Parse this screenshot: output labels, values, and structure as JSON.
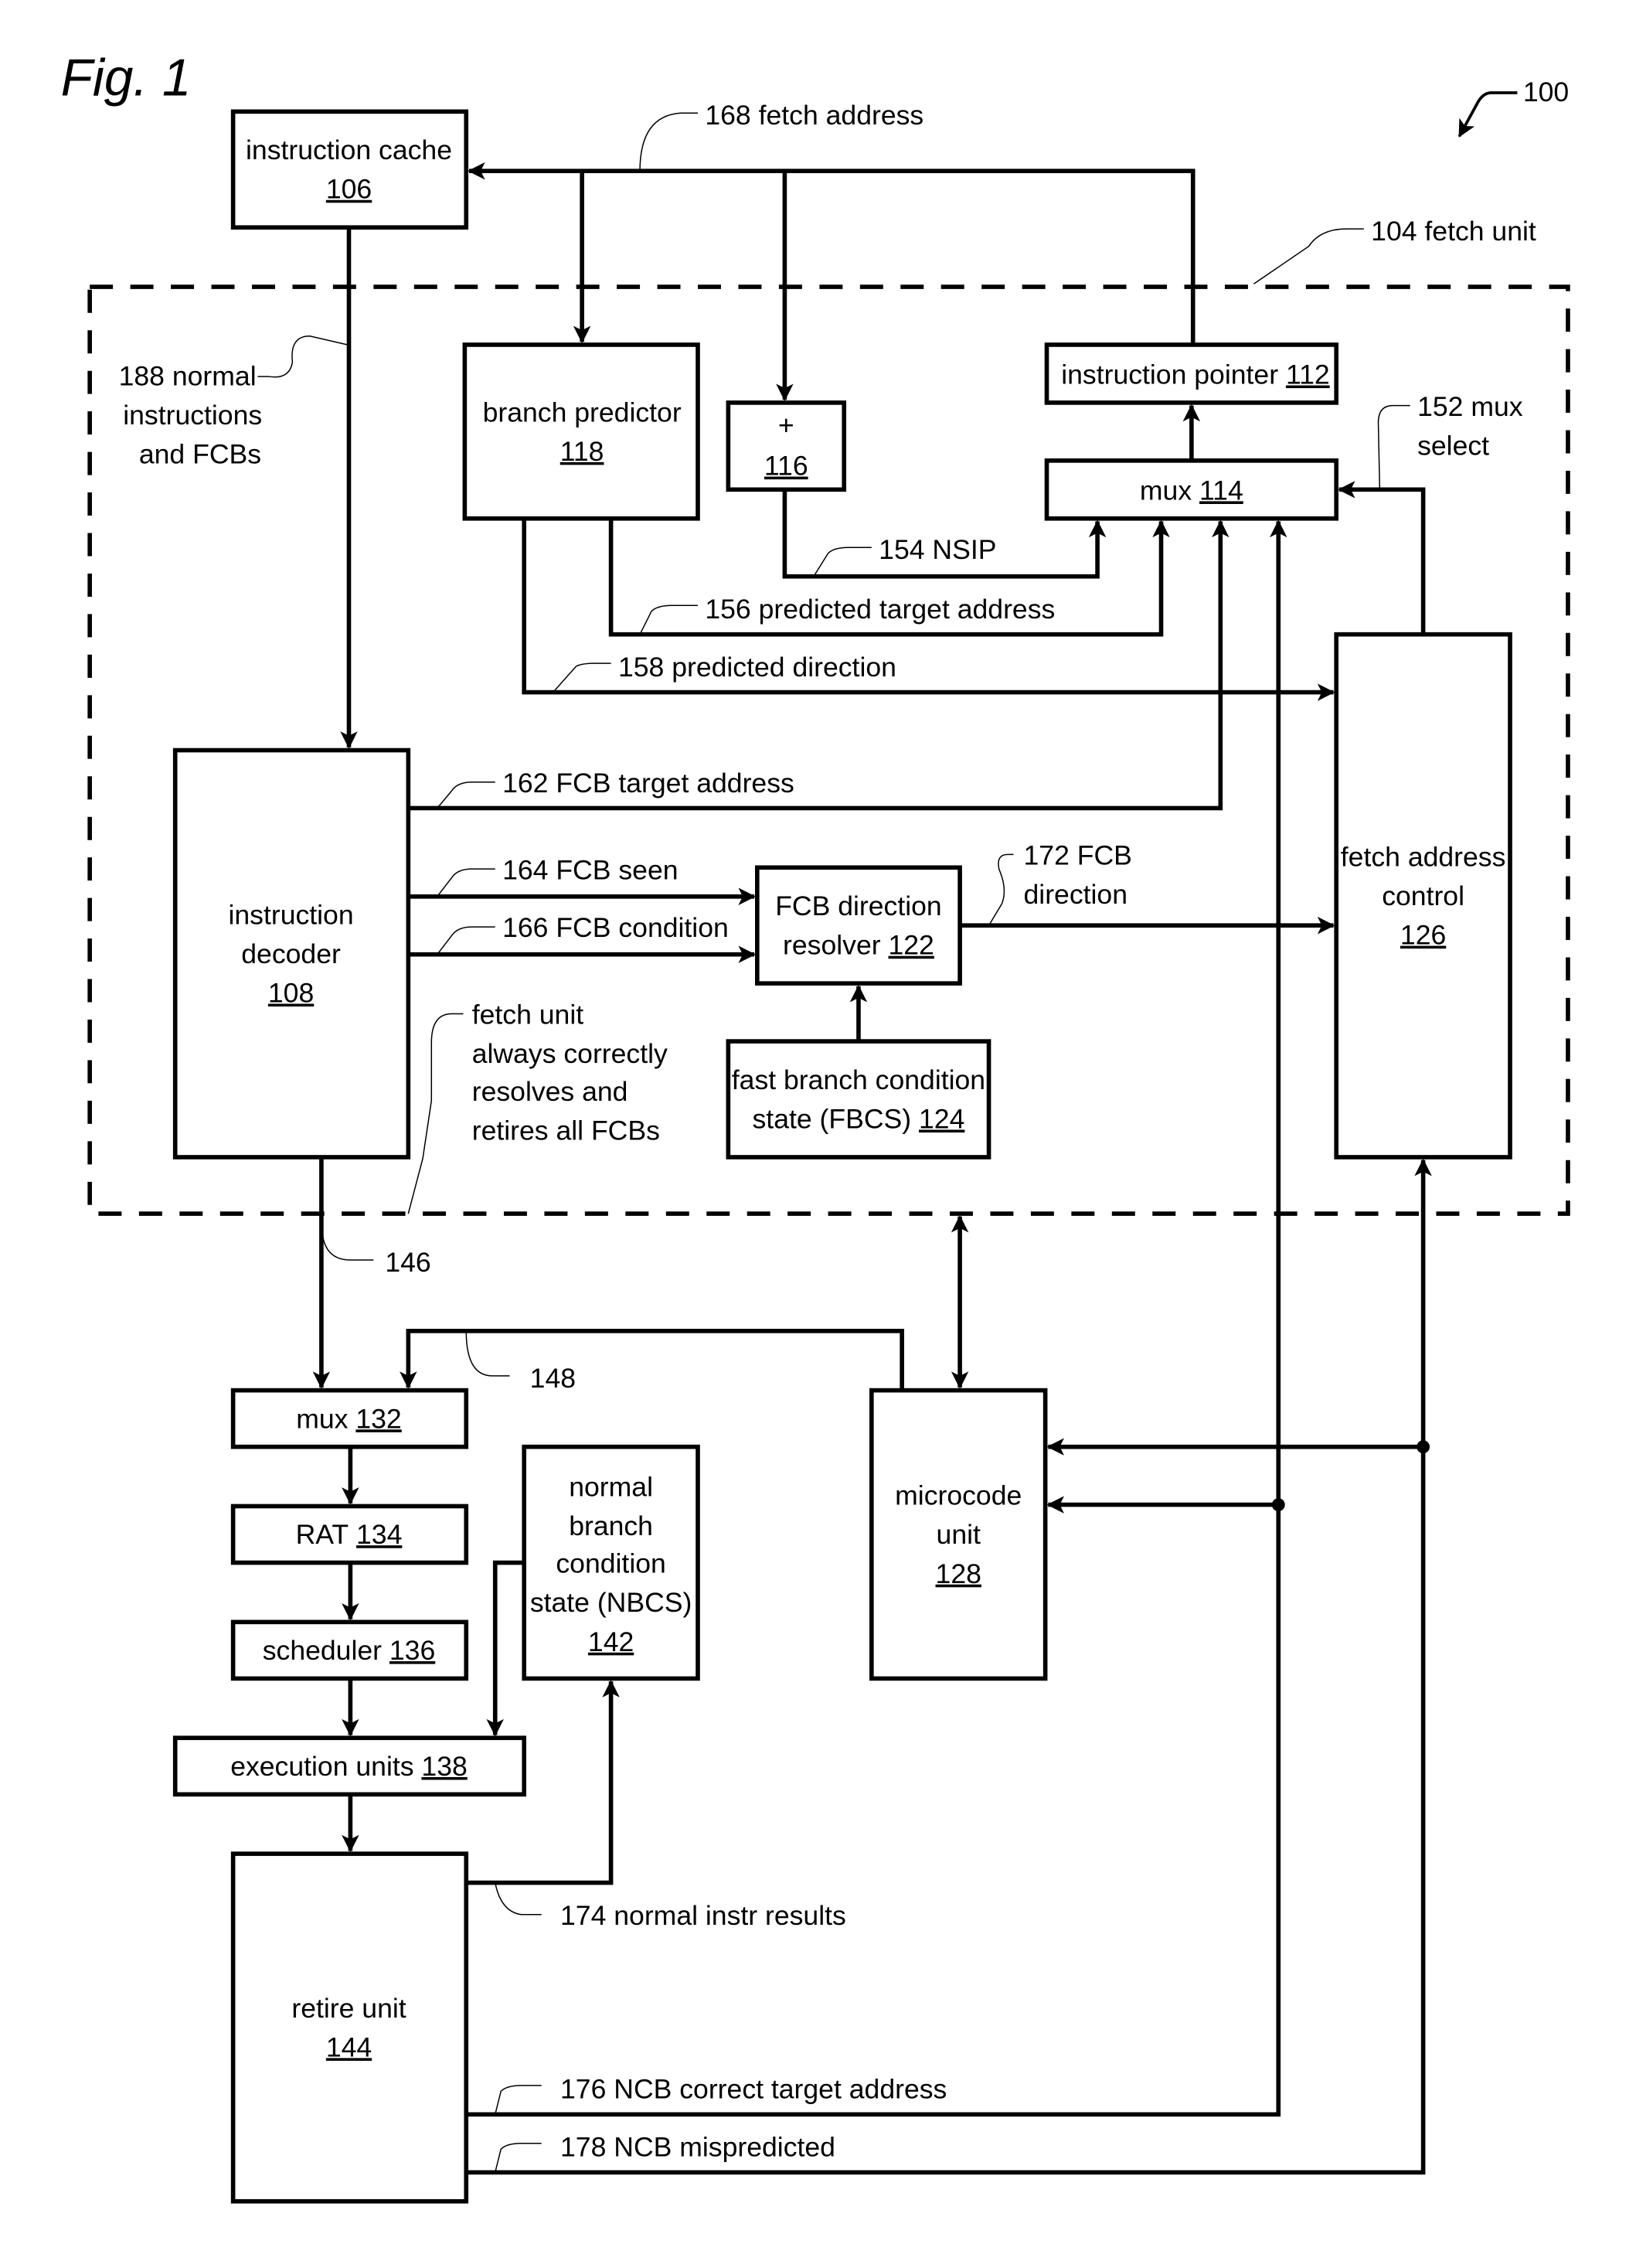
{
  "figure": {
    "title": "Fig. 1",
    "system_ref": "100"
  },
  "blocks": {
    "instruction_cache": {
      "name": "instruction cache",
      "ref": "106"
    },
    "branch_predictor": {
      "name": "branch predictor",
      "ref": "118"
    },
    "adder": {
      "name": "+",
      "ref": "116"
    },
    "instruction_pointer": {
      "name": "instruction pointer",
      "ref": "112"
    },
    "mux_114": {
      "name": "mux",
      "ref": "114"
    },
    "fetch_address_control": {
      "lines": [
        "fetch address",
        "control"
      ],
      "ref": "126"
    },
    "instruction_decoder": {
      "lines": [
        "instruction",
        "decoder"
      ],
      "ref": "108"
    },
    "fcb_direction_resolver": {
      "lines": [
        "FCB direction",
        "resolver"
      ],
      "ref": "122"
    },
    "fbcs": {
      "lines": [
        "fast branch condition",
        "state (FBCS)"
      ],
      "ref": "124"
    },
    "mux_132": {
      "name": "mux",
      "ref": "132"
    },
    "rat": {
      "name": "RAT",
      "ref": "134"
    },
    "scheduler": {
      "name": "scheduler",
      "ref": "136"
    },
    "execution_units": {
      "name": "execution units",
      "ref": "138"
    },
    "nbcs": {
      "lines": [
        "normal",
        "branch",
        "condition",
        "state (NBCS)"
      ],
      "ref": "142"
    },
    "retire_unit": {
      "name": "retire unit",
      "ref": "144"
    },
    "microcode_unit": {
      "lines": [
        "microcode",
        "unit"
      ],
      "ref": "128"
    }
  },
  "signals": {
    "s168": "168 fetch address",
    "s104": "104 fetch unit",
    "s188": [
      "188  normal",
      "instructions",
      "and FCBs"
    ],
    "s152": [
      "152 mux",
      "select"
    ],
    "s154": "154 NSIP",
    "s156": "156 predicted target address",
    "s158": "158 predicted direction",
    "s162": "162 FCB target address",
    "s164": "164 FCB seen",
    "s166": "166 FCB condition",
    "s172": [
      "172 FCB",
      "direction"
    ],
    "note": [
      "fetch unit",
      "always correctly",
      "resolves and",
      "retires all FCBs"
    ],
    "s146": "146",
    "s148": "148",
    "s174": "174 normal instr results",
    "s176": "176 NCB correct target address",
    "s178": "178 NCB mispredicted"
  }
}
